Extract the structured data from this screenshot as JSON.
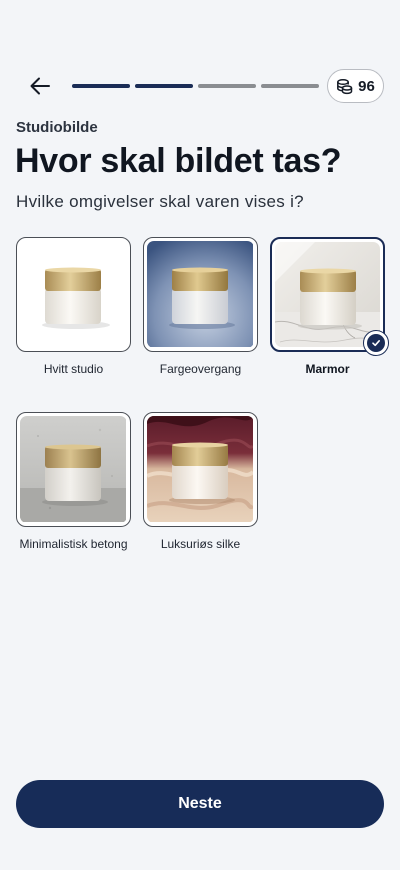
{
  "header": {
    "back_icon": "arrow-left-icon",
    "progress": {
      "total_steps": 4,
      "completed_steps": 2
    },
    "credits": {
      "icon": "coins-icon",
      "value": "96"
    }
  },
  "step_label": "Studiobilde",
  "title": "Hvor skal bildet tas?",
  "subtitle": "Hvilke omgivelser skal varen vises i?",
  "options": [
    {
      "label": "Hvitt studio",
      "selected": false
    },
    {
      "label": "Fargeovergang",
      "selected": false
    },
    {
      "label": "Marmor",
      "selected": true
    },
    {
      "label": "Minimalistisk betong",
      "selected": false
    },
    {
      "label": "Luksuriøs silke",
      "selected": false
    }
  ],
  "next_button": "Neste",
  "colors": {
    "primary": "#172c58",
    "background": "#f3f5f8",
    "progress_inactive": "#8a8d91"
  }
}
